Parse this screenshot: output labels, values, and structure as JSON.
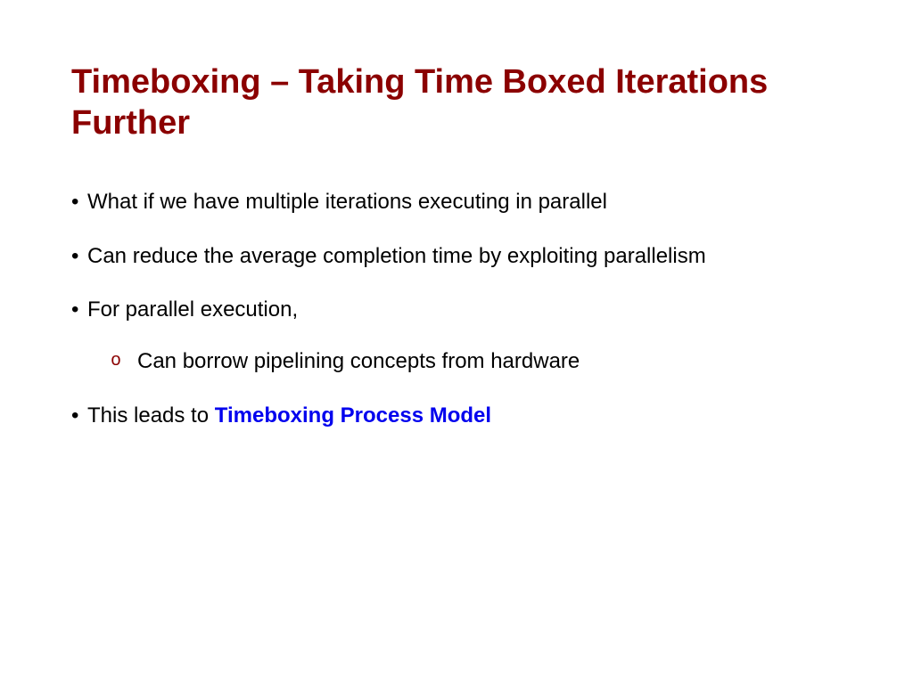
{
  "title": "Timeboxing – Taking Time Boxed Iterations Further",
  "bullets": [
    {
      "text": "What if we have multiple iterations executing in parallel"
    },
    {
      "text": "Can reduce the average completion time by exploiting parallelism"
    },
    {
      "text": "For parallel execution,",
      "sub": [
        {
          "text": "Can borrow pipelining concepts from hardware"
        }
      ]
    },
    {
      "text_prefix": "This leads to ",
      "highlight": "Timeboxing Process Model"
    }
  ]
}
